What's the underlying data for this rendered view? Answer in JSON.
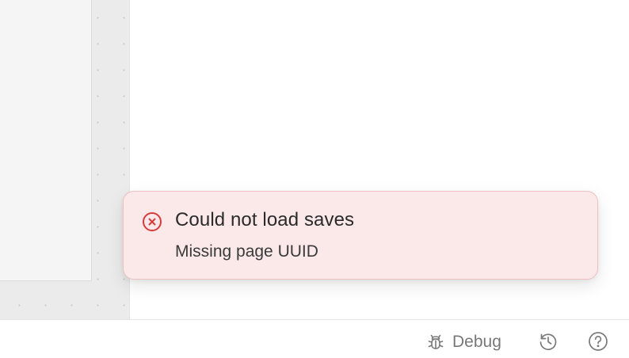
{
  "toast": {
    "type": "error",
    "icon": "error-circle-x-icon",
    "title": "Could not load saves",
    "message": "Missing page UUID"
  },
  "bottom_bar": {
    "debug_label": "Debug",
    "debug_icon": "bug-icon",
    "history_icon": "history-icon",
    "help_icon": "help-circle-icon"
  },
  "colors": {
    "toast_background": "#fbe9e9",
    "toast_border": "#eec1c1",
    "error_accent": "#d93a3a",
    "canvas_background": "#ebebeb",
    "muted_icon": "#777777"
  }
}
